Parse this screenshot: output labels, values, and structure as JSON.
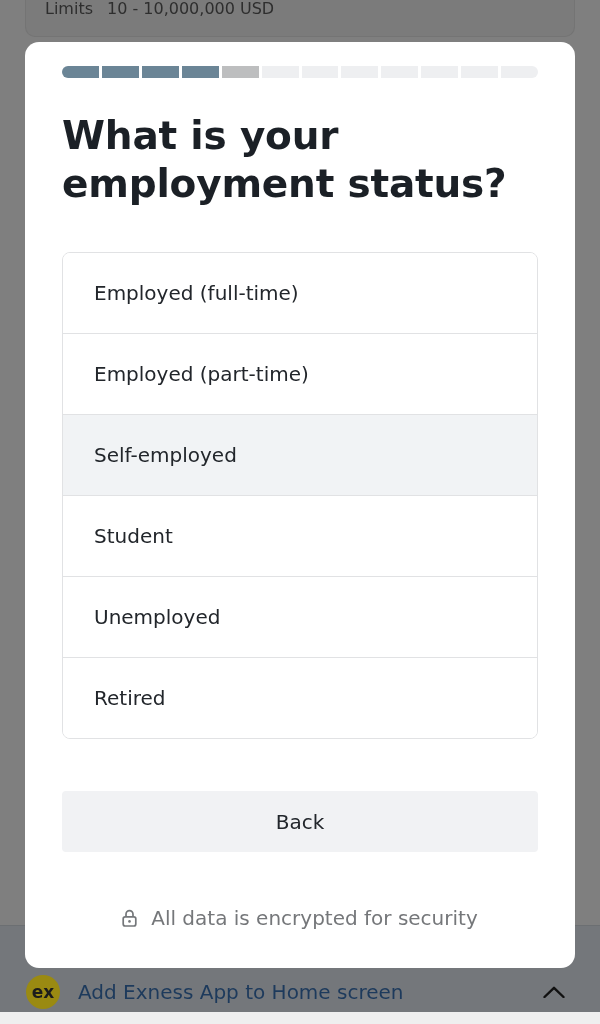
{
  "limits_card": {
    "label": "Limits",
    "value": "10 - 10,000,000 USD"
  },
  "modal": {
    "progress": {
      "steps": [
        {
          "completed": true,
          "current": false
        },
        {
          "completed": true,
          "current": false
        },
        {
          "completed": true,
          "current": false
        },
        {
          "completed": true,
          "current": false
        },
        {
          "completed": false,
          "current": true
        },
        {
          "completed": false,
          "current": false
        },
        {
          "completed": false,
          "current": false
        },
        {
          "completed": false,
          "current": false
        },
        {
          "completed": false,
          "current": false
        },
        {
          "completed": false,
          "current": false
        },
        {
          "completed": false,
          "current": false
        },
        {
          "completed": false,
          "current": false
        }
      ]
    },
    "title": "What is your employment status?",
    "options": [
      {
        "label": "Employed (full-time)",
        "selected": false
      },
      {
        "label": "Employed (part-time)",
        "selected": false
      },
      {
        "label": "Self-employed",
        "selected": true
      },
      {
        "label": "Student",
        "selected": false
      },
      {
        "label": "Unemployed",
        "selected": false
      },
      {
        "label": "Retired",
        "selected": false
      }
    ],
    "back_button": "Back",
    "security_note": "All data is encrypted for security"
  },
  "install_banner": {
    "logo": "ex",
    "text": "Add Exness App to Home screen"
  }
}
